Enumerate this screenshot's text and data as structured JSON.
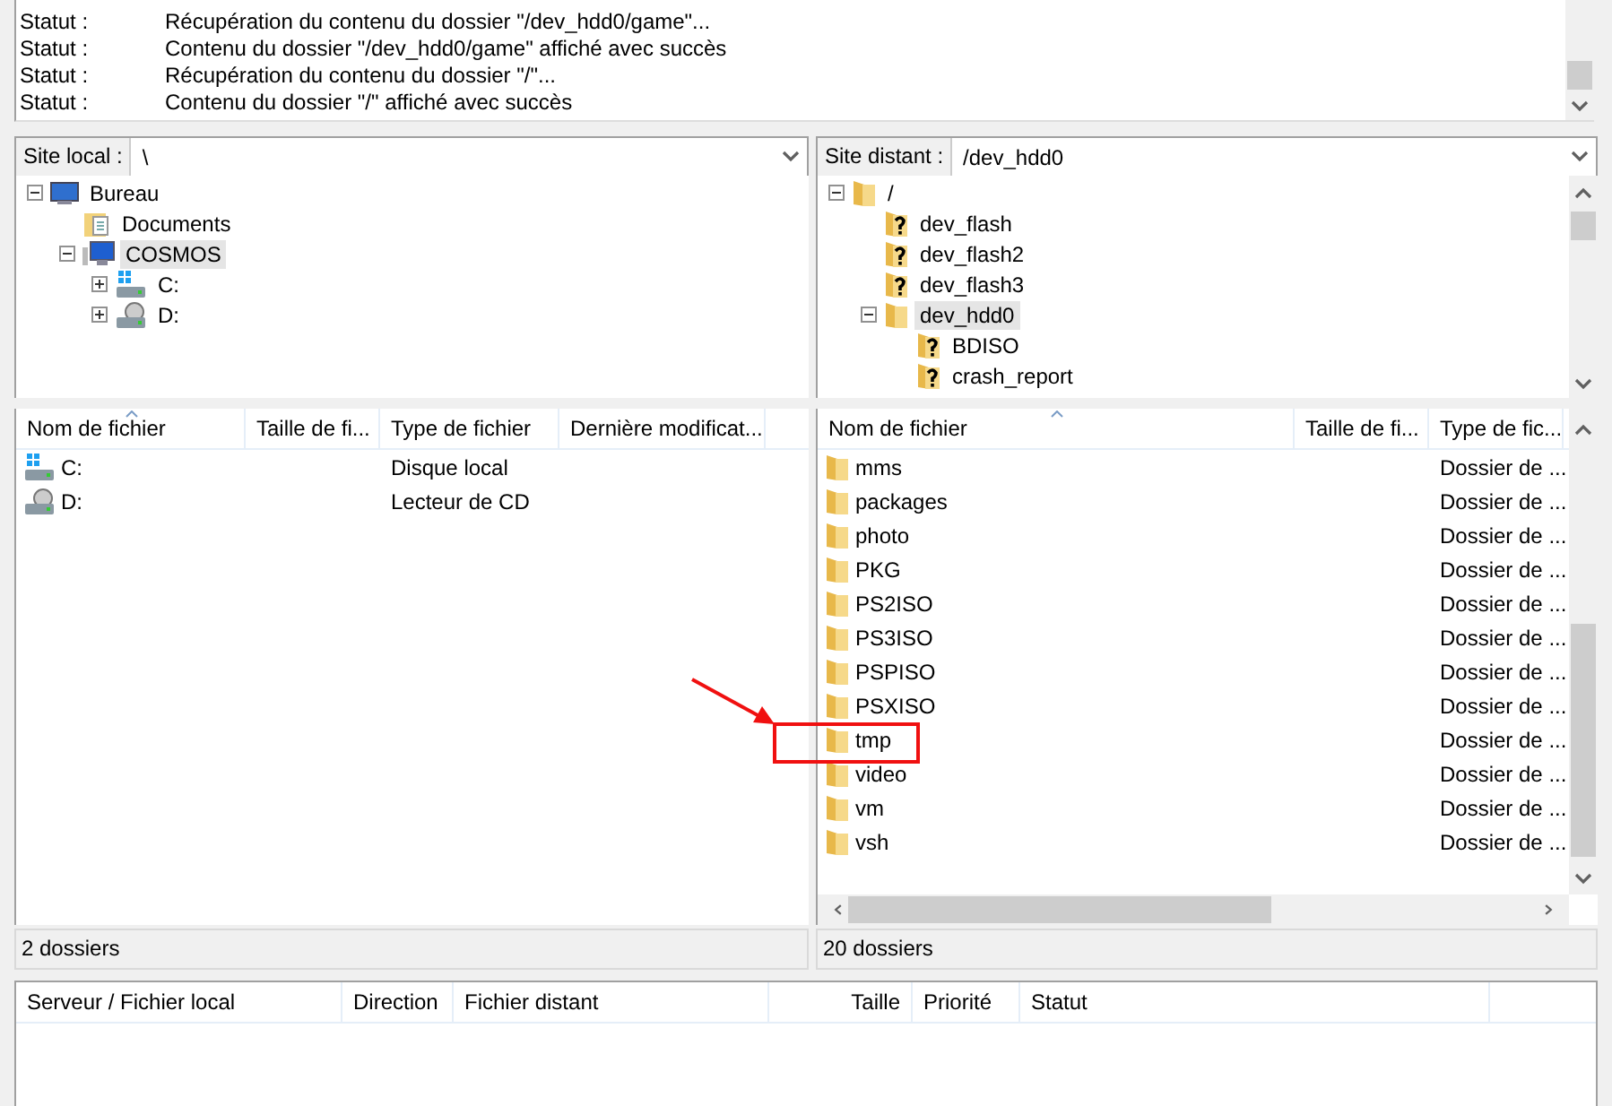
{
  "log": [
    {
      "label": "Statut :",
      "message": "Récupération du contenu du dossier \"/dev_hdd0/game\"..."
    },
    {
      "label": "Statut :",
      "message": "Contenu du dossier \"/dev_hdd0/game\" affiché avec succès"
    },
    {
      "label": "Statut :",
      "message": "Récupération du contenu du dossier \"/\"..."
    },
    {
      "label": "Statut :",
      "message": "Contenu du dossier \"/\" affiché avec succès"
    }
  ],
  "local": {
    "label": "Site local :",
    "path": "\\",
    "tree": [
      {
        "name": "Bureau",
        "kind": "desktop",
        "expanded": true,
        "selected": false,
        "children": [
          {
            "name": "Documents",
            "kind": "documents",
            "selected": false
          },
          {
            "name": "COSMOS",
            "kind": "computer",
            "expanded": true,
            "selected": true,
            "children": [
              {
                "name": "C:",
                "kind": "drive-windows",
                "expanded": false,
                "selected": false
              },
              {
                "name": "D:",
                "kind": "drive-cd",
                "expanded": false,
                "selected": false
              }
            ]
          }
        ]
      }
    ],
    "columns": [
      {
        "label": "Nom de fichier",
        "sorted": true
      },
      {
        "label": "Taille de fi...",
        "sorted": false
      },
      {
        "label": "Type de fichier",
        "sorted": false
      },
      {
        "label": "Dernière modificat...",
        "sorted": false
      }
    ],
    "rows": [
      {
        "name": "C:",
        "kind": "drive-windows",
        "type": "Disque local"
      },
      {
        "name": "D:",
        "kind": "drive-cd",
        "type": "Lecteur de CD"
      }
    ],
    "status": "2 dossiers"
  },
  "remote": {
    "label": "Site distant :",
    "path": "/dev_hdd0",
    "tree": [
      {
        "name": "/",
        "kind": "folder",
        "expanded": true,
        "selected": false,
        "children": [
          {
            "name": "dev_flash",
            "kind": "folder-unknown",
            "selected": false
          },
          {
            "name": "dev_flash2",
            "kind": "folder-unknown",
            "selected": false
          },
          {
            "name": "dev_flash3",
            "kind": "folder-unknown",
            "selected": false
          },
          {
            "name": "dev_hdd0",
            "kind": "folder",
            "expanded": true,
            "selected": true,
            "children": [
              {
                "name": "BDISO",
                "kind": "folder-unknown",
                "selected": false
              },
              {
                "name": "crash_report",
                "kind": "folder-unknown",
                "selected": false
              }
            ]
          }
        ]
      }
    ],
    "columns": [
      {
        "label": "Nom de fichier",
        "sorted": true
      },
      {
        "label": "Taille de fi...",
        "sorted": false
      },
      {
        "label": "Type de fic...",
        "sorted": false
      }
    ],
    "rows": [
      {
        "name": "mms",
        "kind": "folder",
        "type": "Dossier de ..."
      },
      {
        "name": "packages",
        "kind": "folder",
        "type": "Dossier de ..."
      },
      {
        "name": "photo",
        "kind": "folder",
        "type": "Dossier de ..."
      },
      {
        "name": "PKG",
        "kind": "folder",
        "type": "Dossier de ..."
      },
      {
        "name": "PS2ISO",
        "kind": "folder",
        "type": "Dossier de ..."
      },
      {
        "name": "PS3ISO",
        "kind": "folder",
        "type": "Dossier de ..."
      },
      {
        "name": "PSPISO",
        "kind": "folder",
        "type": "Dossier de ..."
      },
      {
        "name": "PSXISO",
        "kind": "folder",
        "type": "Dossier de ..."
      },
      {
        "name": "tmp",
        "kind": "folder",
        "type": "Dossier de ..."
      },
      {
        "name": "video",
        "kind": "folder",
        "type": "Dossier de ..."
      },
      {
        "name": "vm",
        "kind": "folder",
        "type": "Dossier de ..."
      },
      {
        "name": "vsh",
        "kind": "folder",
        "type": "Dossier de ..."
      }
    ],
    "status": "20 dossiers"
  },
  "queue": {
    "columns": [
      {
        "label": "Serveur / Fichier local"
      },
      {
        "label": "Direction"
      },
      {
        "label": "Fichier distant"
      },
      {
        "label": "Taille"
      },
      {
        "label": "Priorité"
      },
      {
        "label": "Statut"
      }
    ]
  }
}
